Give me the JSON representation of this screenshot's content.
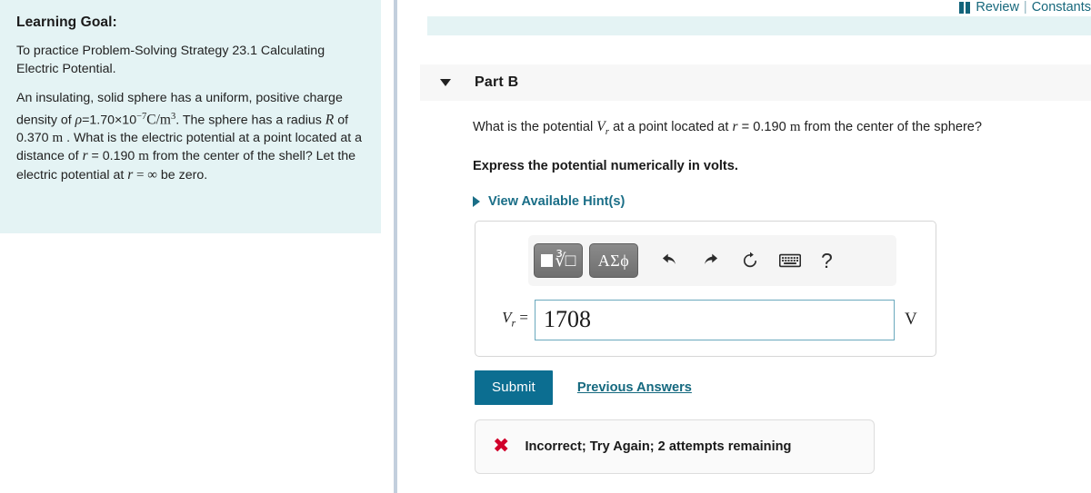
{
  "left_panel": {
    "heading": "Learning Goal:",
    "paragraph1": "To practice Problem-Solving Strategy 23.1 Calculating Electric Potential.",
    "problem": {
      "part1": "An insulating, solid sphere has a uniform, positive charge density of ",
      "rho_symbol": "ρ",
      "rho_eq": "=1.70×10",
      "rho_exp": "−7",
      "rho_unit": "C/m",
      "rho_unit_exp": "3",
      "part2": ". The sphere has a radius ",
      "R_symbol": "R",
      "part3": " of 0.370 ",
      "unit_m": "m",
      "part4": " . What is the electric potential at a point located at a distance of ",
      "r_symbol": "r",
      "part5": " = 0.190 ",
      "unit_m2": "m",
      "part6": " from the center of the shell? Let the electric potential at ",
      "r_symbol2": "r",
      "part7": " = ",
      "infinity": "∞",
      "part8": " be zero."
    }
  },
  "topbar": {
    "review_label": "Review",
    "separator": "|",
    "constants_label": "Constants"
  },
  "part_header": {
    "title": "Part B"
  },
  "question": {
    "prefix": "What is the potential ",
    "variable": "V",
    "variable_sub": "r",
    "middle": " at a point located at ",
    "r_var": "r",
    "value": " = 0.190 ",
    "unit": "m",
    "suffix": " from the center of the sphere?",
    "instruction": "Express the potential numerically in volts.",
    "hints_label": "View Available Hint(s)"
  },
  "math_toolbar": {
    "template_button": "template-root-button",
    "template_glyph": "√□",
    "greek_button_label": "ΑΣϕ",
    "undo": "undo-arrow",
    "redo": "redo-arrow",
    "reset": "reset-arrow",
    "keyboard": "keyboard-icon",
    "help_label": "?"
  },
  "answer": {
    "label_var": "V",
    "label_sub": "r",
    "label_eq": " =",
    "value": "1708",
    "placeholder": "",
    "unit": "V"
  },
  "actions": {
    "submit_label": "Submit",
    "previous_answers_label": "Previous Answers"
  },
  "feedback": {
    "icon": "✖",
    "message": "Incorrect; Try Again; 2 attempts remaining",
    "color": "#d1002a"
  },
  "colors": {
    "panel_cyan": "#e4f3f4",
    "accent_teal": "#0c6e91",
    "link_teal": "#15697f",
    "header_gray": "#f7f7f7",
    "input_border": "#6aa9bd"
  }
}
